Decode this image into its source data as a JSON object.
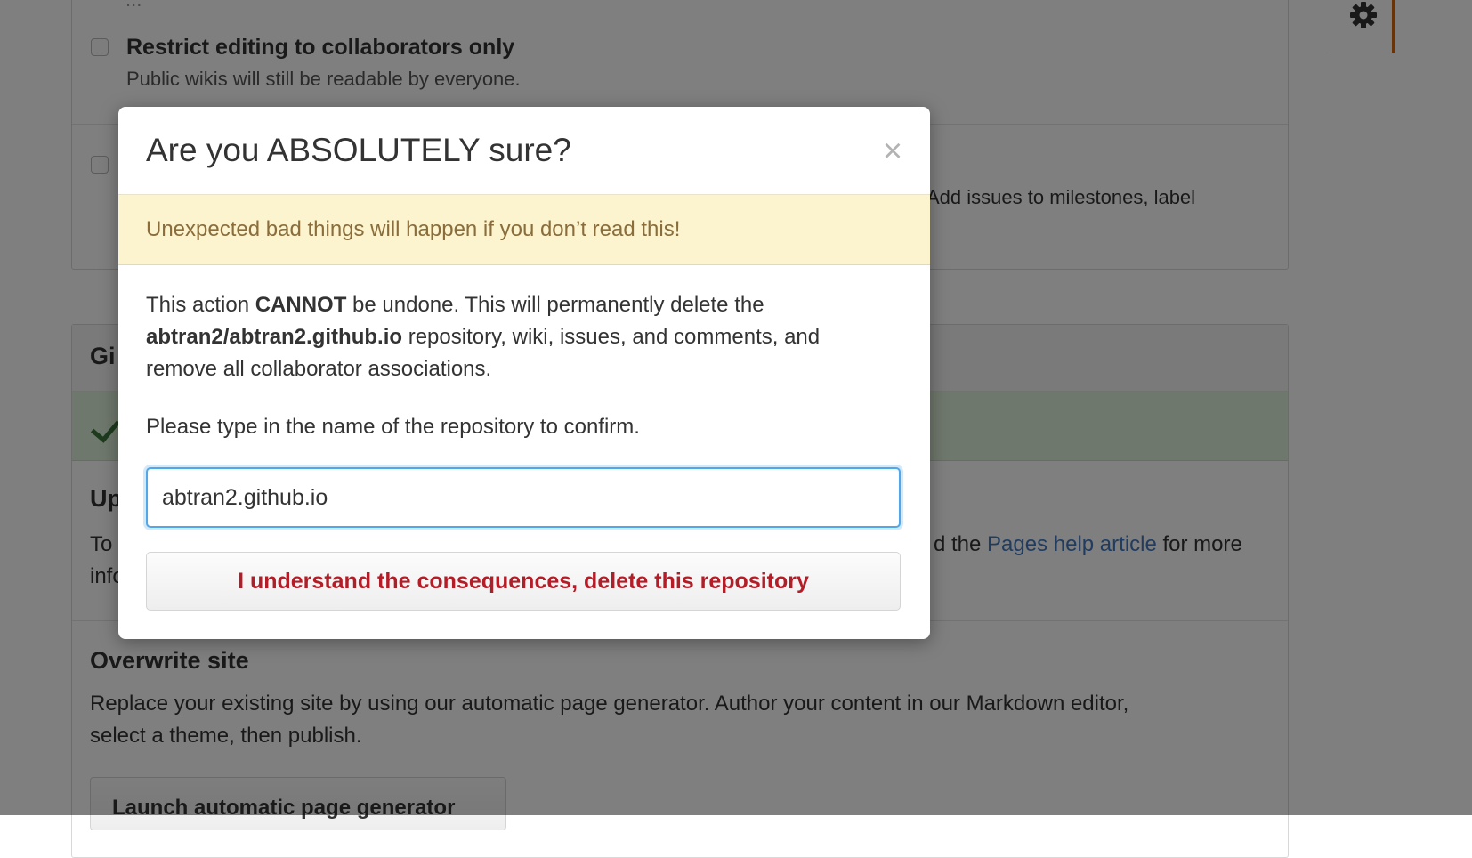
{
  "background": {
    "options": [
      {
        "title": "Restrict editing to collaborators only",
        "description": "Public wikis will still be readable by everyone."
      },
      {
        "title": "",
        "description": "Add issues to milestones, label"
      }
    ],
    "partial_top_text": "...",
    "pages_panel": {
      "header_partial": "Gi",
      "update_title_partial": "Up",
      "update_text_left_line1": "To",
      "update_text_left_line2": "info",
      "update_text_right_prefix": "d the ",
      "update_link": "Pages help article",
      "update_text_right_suffix": " for more",
      "overwrite_title": "Overwrite site",
      "overwrite_text_line1": "Replace your existing site by using our automatic page generator. Author your content in our Markdown editor,",
      "overwrite_text_line2": "select a theme, then publish.",
      "generator_button": "Launch automatic page generator"
    }
  },
  "modal": {
    "title": "Are you ABSOLUTELY sure?",
    "close_symbol": "×",
    "warning": "Unexpected bad things will happen if you don’t read this!",
    "body": {
      "p1_part1": "This action ",
      "p1_bold": "CANNOT",
      "p1_part2": " be undone. This will permanently delete the",
      "p1_repo": "abtran2/abtran2.github.io",
      "p1_part3": " repository, wiki, issues, and comments, and",
      "p1_part4": "remove all collaborator associations."
    },
    "confirm_prompt": "Please type in the name of the repository to confirm.",
    "input_value": "abtran2.github.io",
    "confirm_button": "I understand the consequences, delete this repository"
  },
  "colors": {
    "danger": "#b31d28",
    "warning_bg": "#fcf3cf",
    "warning_text": "#8a6d3b",
    "focus": "#51a7e8",
    "accent_bar": "#d26911"
  }
}
